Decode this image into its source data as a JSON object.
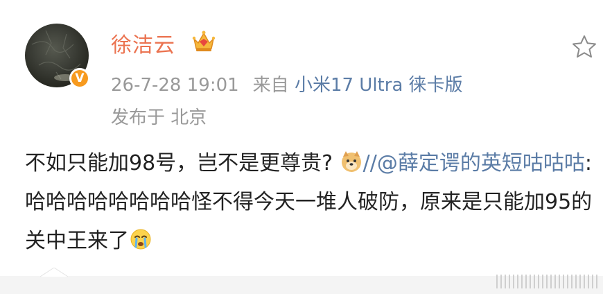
{
  "post": {
    "username": "徐洁云",
    "verified_badge": "V",
    "timestamp": "26-7-28 19:01",
    "source_prefix": "来自",
    "source": "小米17 Ultra 徕卡版",
    "location": "发布于 北京",
    "content": {
      "text1": "不如只能加98号，岂不是更尊贵?",
      "repost_sep": "//",
      "mention": "@薛定谔的英短咕咕咕",
      "text2": ":哈哈哈哈哈哈哈哈怪不得今天一堆人破防，原来是只能加95的关中王来了"
    }
  },
  "icons": {
    "avatar": "avatar",
    "crown": "vip-crown-icon",
    "verified": "verified-badge-icon",
    "favorite": "star-outline-icon",
    "emoji1": "doge-emoji",
    "emoji2": "crying-emoji"
  },
  "colors": {
    "username": "#eb7350",
    "link": "#5b7ca6",
    "meta": "#999999",
    "text": "#222222",
    "badge": "#f79a1e"
  }
}
